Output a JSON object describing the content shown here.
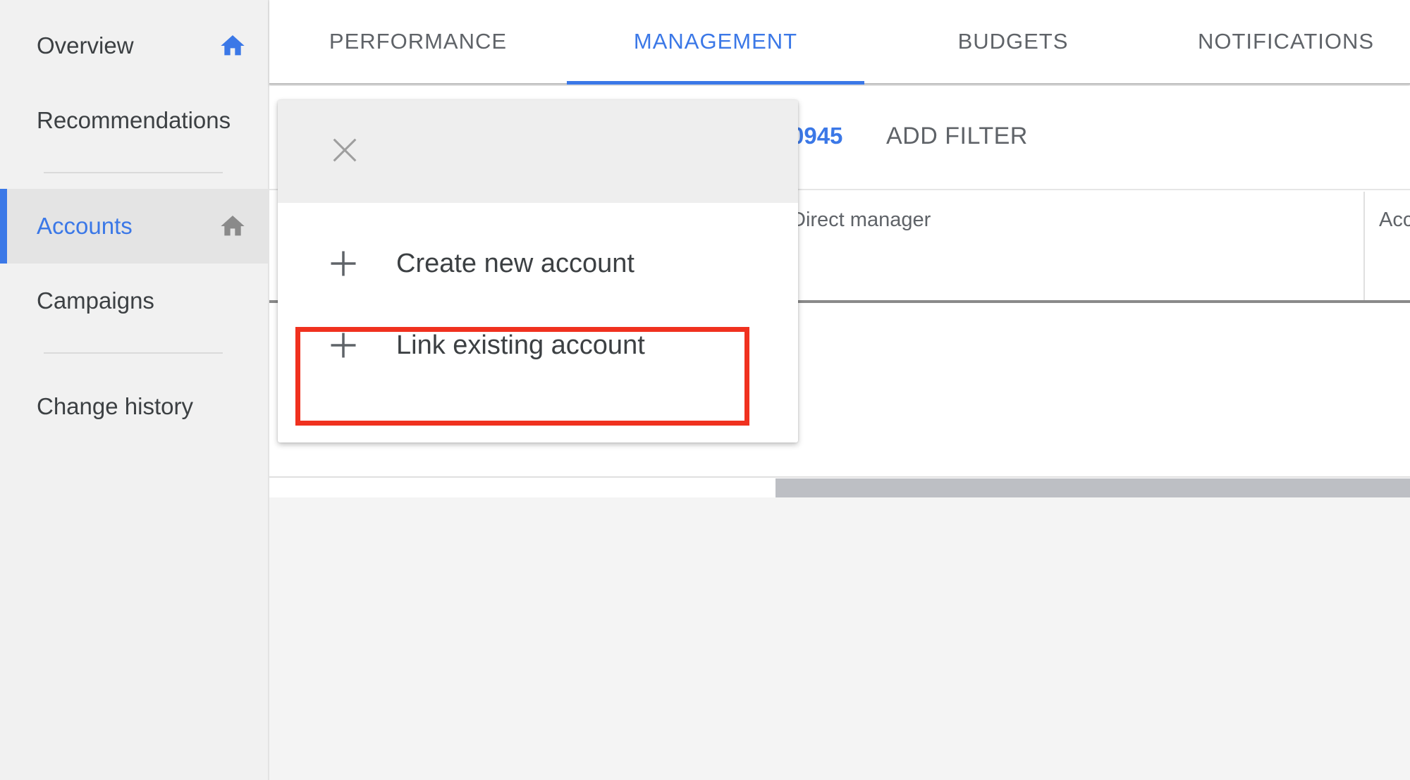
{
  "sidebar": {
    "items": [
      {
        "label": "Overview",
        "icon": "home-icon",
        "icon_color": "#3b78e7"
      },
      {
        "label": "Recommendations"
      },
      {
        "label": "Accounts",
        "icon": "home-icon",
        "icon_color": "#8a8a8a",
        "active": true
      },
      {
        "label": "Campaigns"
      },
      {
        "label": "Change history"
      }
    ]
  },
  "tabs": [
    {
      "label": "PERFORMANCE"
    },
    {
      "label": "MANAGEMENT",
      "active": true
    },
    {
      "label": "BUDGETS"
    },
    {
      "label": "NOTIFICATIONS"
    }
  ],
  "filter_bar": {
    "partial_chip_text": "0945",
    "add_filter_label": "ADD FILTER"
  },
  "table": {
    "columns": [
      "Direct manager",
      "Acc"
    ]
  },
  "menu": {
    "close_icon": "close-icon",
    "items": [
      {
        "label": "Create new account",
        "icon": "plus-icon"
      },
      {
        "label": "Link existing account",
        "icon": "plus-icon",
        "highlighted": true
      }
    ]
  },
  "colors": {
    "accent": "#3b78e7",
    "highlight": "#f0311f",
    "text": "#3c4043",
    "muted": "#5f6368"
  }
}
